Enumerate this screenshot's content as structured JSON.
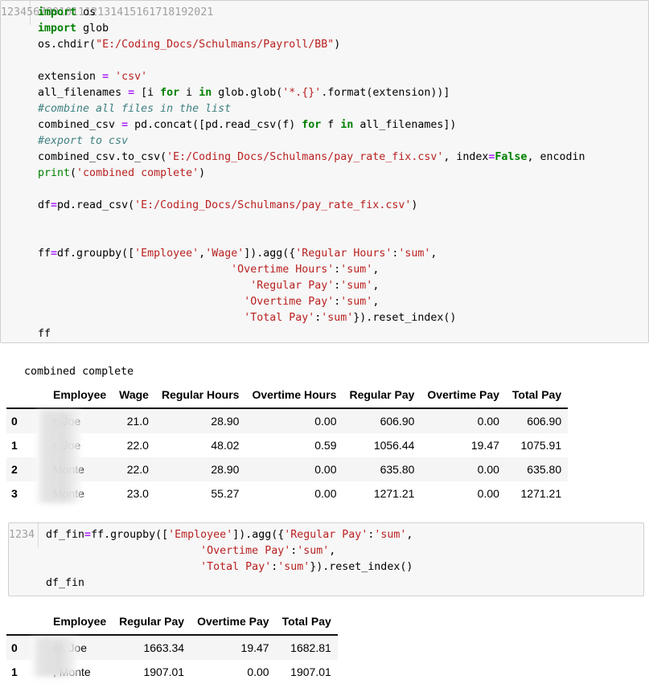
{
  "notebook": {
    "cells": [
      {
        "type": "code",
        "name": "code-cell-1",
        "line_numbers": [
          "1",
          "2",
          "3",
          "4",
          "5",
          "6",
          "7",
          "8",
          "9",
          "10",
          "11",
          "12",
          "13",
          "14",
          "15",
          "16",
          "17",
          "18",
          "19",
          "20",
          "21"
        ],
        "lines": [
          "import os",
          "import glob",
          "os.chdir(\"E:/Coding_Docs/Schulmans/Payroll/BB\")",
          "",
          "extension = 'csv'",
          "all_filenames = [i for i in glob.glob('*.{}'.format(extension))]",
          "#combine all files in the list",
          "combined_csv = pd.concat([pd.read_csv(f) for f in all_filenames])",
          "#export to csv",
          "combined_csv.to_csv('E:/Coding_Docs/Schulmans/pay_rate_fix.csv', index=False, encoding",
          "print('combined complete')",
          "",
          "df=pd.read_csv('E:/Coding_Docs/Schulmans/pay_rate_fix.csv')",
          "",
          "",
          "ff=df.groupby(['Employee','Wage']).agg({'Regular Hours':'sum',",
          "                              'Overtime Hours':'sum',",
          "                                 'Regular Pay':'sum',",
          "                                'Overtime Pay':'sum',",
          "                                'Total Pay':'sum'}).reset_index()",
          "ff"
        ]
      },
      {
        "type": "stdout",
        "name": "stdout-output-1",
        "text": "combined complete"
      },
      {
        "type": "dataframe",
        "name": "dataframe-output-1",
        "columns": [
          "Employee",
          "Wage",
          "Regular Hours",
          "Overtime Hours",
          "Regular Pay",
          "Overtime Pay",
          "Total Pay"
        ],
        "index": [
          "0",
          "1",
          "2",
          "3"
        ],
        "rows": [
          [
            "r, Joe",
            "21.0",
            "28.90",
            "0.00",
            "606.90",
            "0.00",
            "606.90"
          ],
          [
            "r, Joe",
            "22.0",
            "48.02",
            "0.59",
            "1056.44",
            "19.47",
            "1075.91"
          ],
          [
            "Monte",
            "22.0",
            "28.90",
            "0.00",
            "635.80",
            "0.00",
            "635.80"
          ],
          [
            "Monte",
            "23.0",
            "55.27",
            "0.00",
            "1271.21",
            "0.00",
            "1271.21"
          ]
        ]
      },
      {
        "type": "code",
        "name": "code-cell-2",
        "line_numbers": [
          "1",
          "2",
          "3",
          "4"
        ],
        "lines": [
          "df_fin=ff.groupby(['Employee']).agg({'Regular Pay':'sum',",
          "                        'Overtime Pay':'sum',",
          "                        'Total Pay':'sum'}).reset_index()",
          "df_fin"
        ]
      },
      {
        "type": "dataframe",
        "name": "dataframe-output-2",
        "columns": [
          "Employee",
          "Regular Pay",
          "Overtime Pay",
          "Total Pay"
        ],
        "index": [
          "0",
          "1"
        ],
        "rows": [
          [
            "er, Joe",
            "1663.34",
            "19.47",
            "1682.81"
          ],
          [
            ", Monte",
            "1907.01",
            "0.00",
            "1907.01"
          ]
        ]
      }
    ]
  },
  "colors": {
    "keyword": "#008000",
    "string": "#ba2121",
    "comment": "#408080",
    "operator": "#aa22ff",
    "cell_background": "#f7f7f7",
    "cell_border": "#cfcfcf",
    "gutter_text": "#a0a0a0",
    "row_stripe": "#f5f5f5",
    "text": "#000000"
  }
}
